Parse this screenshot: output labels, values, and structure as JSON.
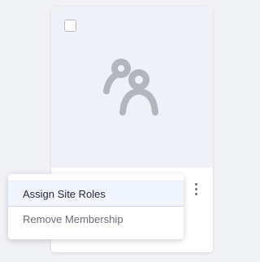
{
  "card": {
    "icon": "users-icon",
    "checkbox_checked": false
  },
  "menu": {
    "items": [
      {
        "label": "Assign Site Roles",
        "state": "hovered"
      },
      {
        "label": "Remove Membership",
        "state": "default"
      }
    ]
  },
  "colors": {
    "page_background": "#f1f2f5",
    "card_image_background": "#eff1f7",
    "icon_color": "#b3b6bd",
    "menu_hover_background": "#f0f5ff",
    "primary_text": "#272833",
    "secondary_text": "#6b6c7e"
  }
}
